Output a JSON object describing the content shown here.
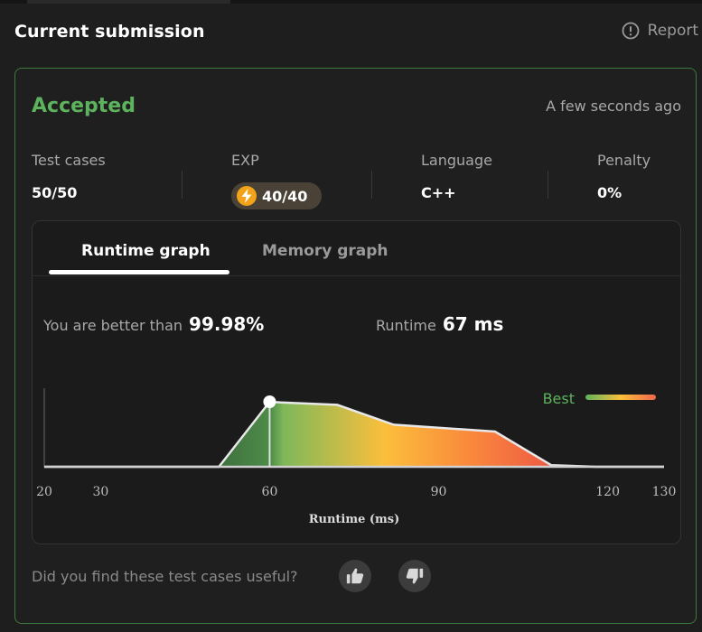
{
  "header": {
    "title": "Current submission",
    "report_label": "Report"
  },
  "submission": {
    "status": "Accepted",
    "time": "A few seconds ago",
    "stats": [
      {
        "label": "Test cases",
        "value": "50/50"
      },
      {
        "label": "EXP",
        "value": "40/40"
      },
      {
        "label": "Language",
        "value": "C++"
      },
      {
        "label": "Penalty",
        "value": "0%"
      }
    ]
  },
  "tabs": [
    {
      "label": "Runtime graph",
      "active": true
    },
    {
      "label": "Memory graph",
      "active": false
    }
  ],
  "summary": {
    "better_label": "You are better than",
    "better_value": "99.98%",
    "runtime_label": "Runtime",
    "runtime_value": "67 ms"
  },
  "legend": {
    "label": "Best",
    "gradient": [
      "#5db35d",
      "#fbbf3c",
      "#f0674a"
    ]
  },
  "colors": {
    "accent": "#5db35d",
    "border": "#3e7a3e",
    "exp_badge": "#f3a319"
  },
  "chart_data": {
    "type": "area",
    "xlabel": "Runtime (ms)",
    "ylabel": "",
    "xticks": [
      20,
      30,
      60,
      90,
      120,
      130
    ],
    "xlim": [
      20,
      130
    ],
    "ylim": [
      0,
      1
    ],
    "legend_position": "top-right",
    "series": [
      {
        "name": "Best",
        "x": [
          20,
          51,
          60,
          62,
          72,
          82,
          100,
          110,
          118,
          130
        ],
        "y": [
          0,
          0,
          0.85,
          0.84,
          0.81,
          0.55,
          0.46,
          0.02,
          0,
          0
        ]
      }
    ],
    "marker": {
      "x": 60,
      "y": 0.85
    }
  },
  "feedback": {
    "question": "Did you find these test cases useful?",
    "like_icon": "thumbs-up-icon",
    "dislike_icon": "thumbs-down-icon"
  }
}
